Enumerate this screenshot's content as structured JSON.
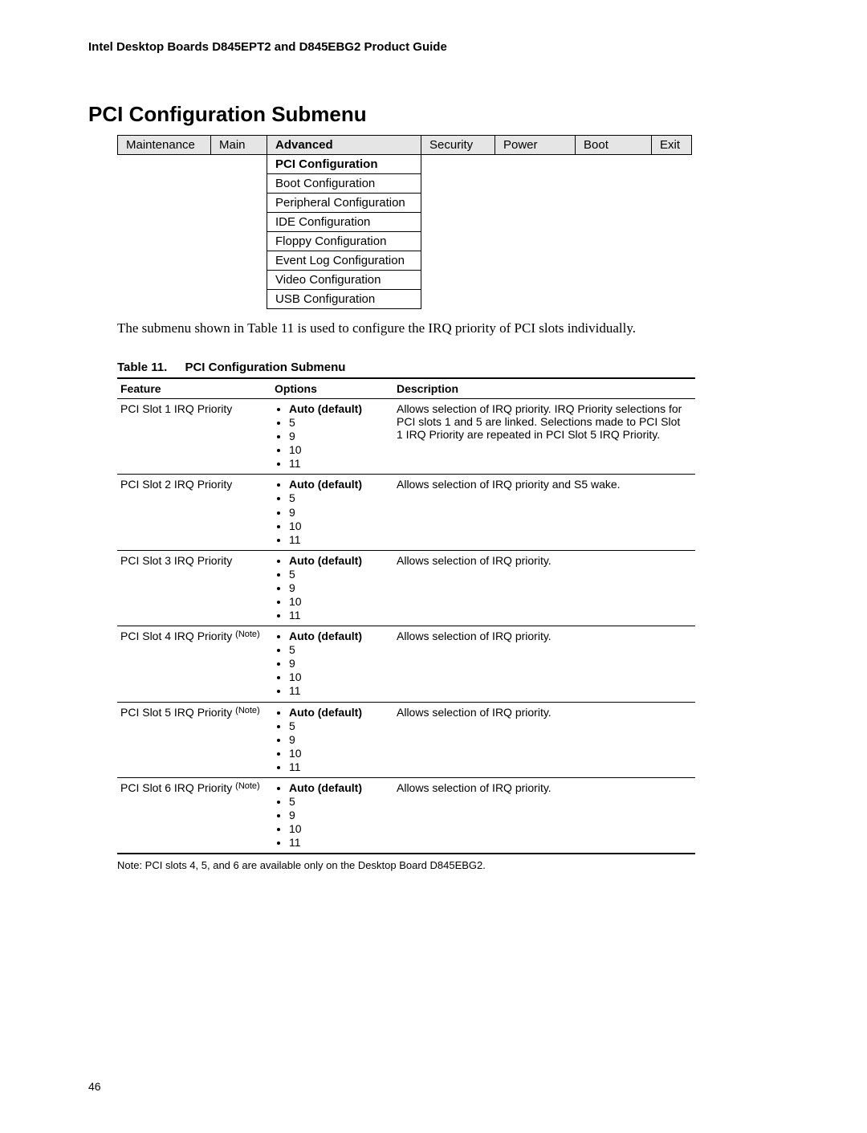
{
  "doc_header": "Intel Desktop Boards D845EPT2 and D845EBG2 Product Guide",
  "section_title": "PCI Configuration Submenu",
  "menu_tabs": {
    "t0": "Maintenance",
    "t1": "Main",
    "t2": "Advanced",
    "t3": "Security",
    "t4": "Power",
    "t5": "Boot",
    "t6": "Exit"
  },
  "submenu": {
    "s0": "PCI Configuration",
    "s1": "Boot Configuration",
    "s2": "Peripheral Configuration",
    "s3": "IDE Configuration",
    "s4": "Floppy  Configuration",
    "s5": "Event Log Configuration",
    "s6": "Video Configuration",
    "s7": "USB Configuration"
  },
  "intro_text": "The submenu shown in Table 11 is used to configure the IRQ priority of PCI slots individually.",
  "table_caption_num": "Table 11.",
  "table_caption_title": "PCI Configuration Submenu",
  "headers": {
    "feature": "Feature",
    "options": "Options",
    "description": "Description"
  },
  "opts_labels": {
    "auto": "Auto (default)",
    "o5": "5",
    "o9": "9",
    "o10": "10",
    "o11": "11"
  },
  "rows": {
    "r1": {
      "feature": "PCI Slot 1 IRQ Priority",
      "desc": "Allows selection of IRQ priority.  IRQ Priority selections for PCI slots 1 and 5 are linked.  Selections made to PCI Slot 1 IRQ Priority are repeated in PCI Slot 5 IRQ Priority."
    },
    "r2": {
      "feature": "PCI Slot 2 IRQ Priority",
      "desc": "Allows selection of IRQ priority and S5 wake."
    },
    "r3": {
      "feature": "PCI Slot 3 IRQ Priority",
      "desc": "Allows selection of IRQ priority."
    },
    "r4": {
      "feature": "PCI Slot 4 IRQ Priority ",
      "note": "(Note)",
      "desc": "Allows selection of IRQ priority."
    },
    "r5": {
      "feature": "PCI Slot 5 IRQ Priority ",
      "note": "(Note)",
      "desc": "Allows selection of IRQ priority."
    },
    "r6": {
      "feature": "PCI Slot 6 IRQ Priority ",
      "note": "(Note)",
      "desc": "Allows selection of IRQ priority."
    }
  },
  "foot_note": "Note:  PCI slots 4, 5, and 6 are available only on the Desktop Board D845EBG2.",
  "page_number": "46"
}
